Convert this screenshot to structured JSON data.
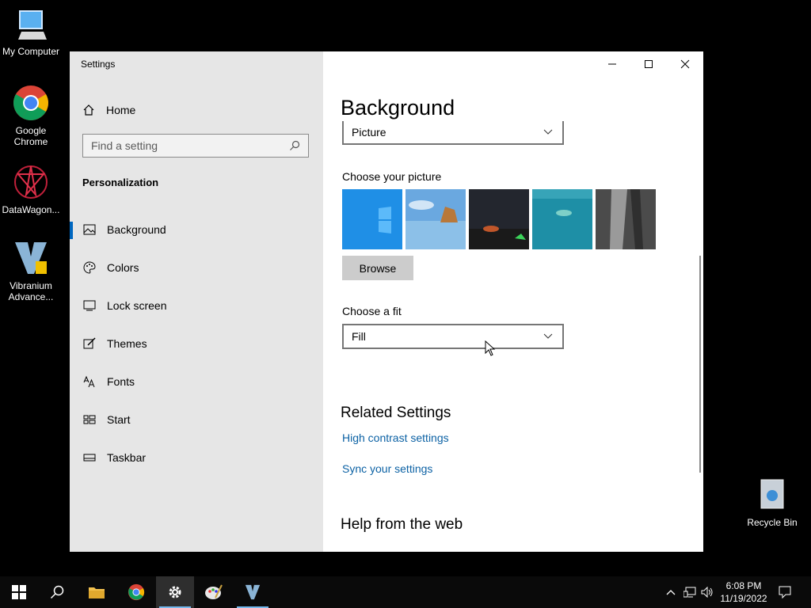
{
  "desktop": {
    "icons": [
      {
        "label": "My Computer",
        "icon": "monitor-icon"
      },
      {
        "label": "Google Chrome",
        "icon": "chrome-icon"
      },
      {
        "label": "DataWagon...",
        "icon": "datawagon-icon"
      },
      {
        "label": "Vibranium Advance...",
        "icon": "vibranium-icon"
      }
    ],
    "recycle_bin": {
      "label": "Recycle Bin",
      "icon": "recycle-bin-icon"
    }
  },
  "window": {
    "title": "Settings",
    "controls": {
      "minimize": "minimize-icon",
      "maximize": "maximize-icon",
      "close": "close-icon"
    }
  },
  "sidebar": {
    "home_label": "Home",
    "search_placeholder": "Find a setting",
    "section_title": "Personalization",
    "items": [
      {
        "label": "Background",
        "icon": "picture-icon",
        "selected": true
      },
      {
        "label": "Colors",
        "icon": "palette-icon"
      },
      {
        "label": "Lock screen",
        "icon": "lock-screen-icon"
      },
      {
        "label": "Themes",
        "icon": "brush-icon"
      },
      {
        "label": "Fonts",
        "icon": "fonts-icon"
      },
      {
        "label": "Start",
        "icon": "start-icon"
      },
      {
        "label": "Taskbar",
        "icon": "taskbar-icon"
      }
    ]
  },
  "main": {
    "title": "Background",
    "background_dropdown": {
      "value": "Picture"
    },
    "choose_picture_label": "Choose your picture",
    "browse_label": "Browse",
    "choose_fit_label": "Choose a fit",
    "fit_dropdown": {
      "value": "Fill"
    },
    "related_title": "Related Settings",
    "links": [
      "High contrast settings",
      "Sync your settings"
    ],
    "help_title": "Help from the web"
  },
  "taskbar": {
    "time": "6:08 PM",
    "date": "11/19/2022",
    "apps": [
      "start-icon",
      "search-icon",
      "file-explorer-icon",
      "chrome-icon",
      "settings-gear-icon",
      "paint-icon",
      "vibranium-icon"
    ],
    "tray": [
      "chevron-up-icon",
      "network-icon",
      "volume-icon",
      "notification-icon"
    ]
  },
  "colors": {
    "accent": "#0067c0",
    "link": "#0b61a4",
    "sidebar_bg": "#e6e6e6"
  }
}
